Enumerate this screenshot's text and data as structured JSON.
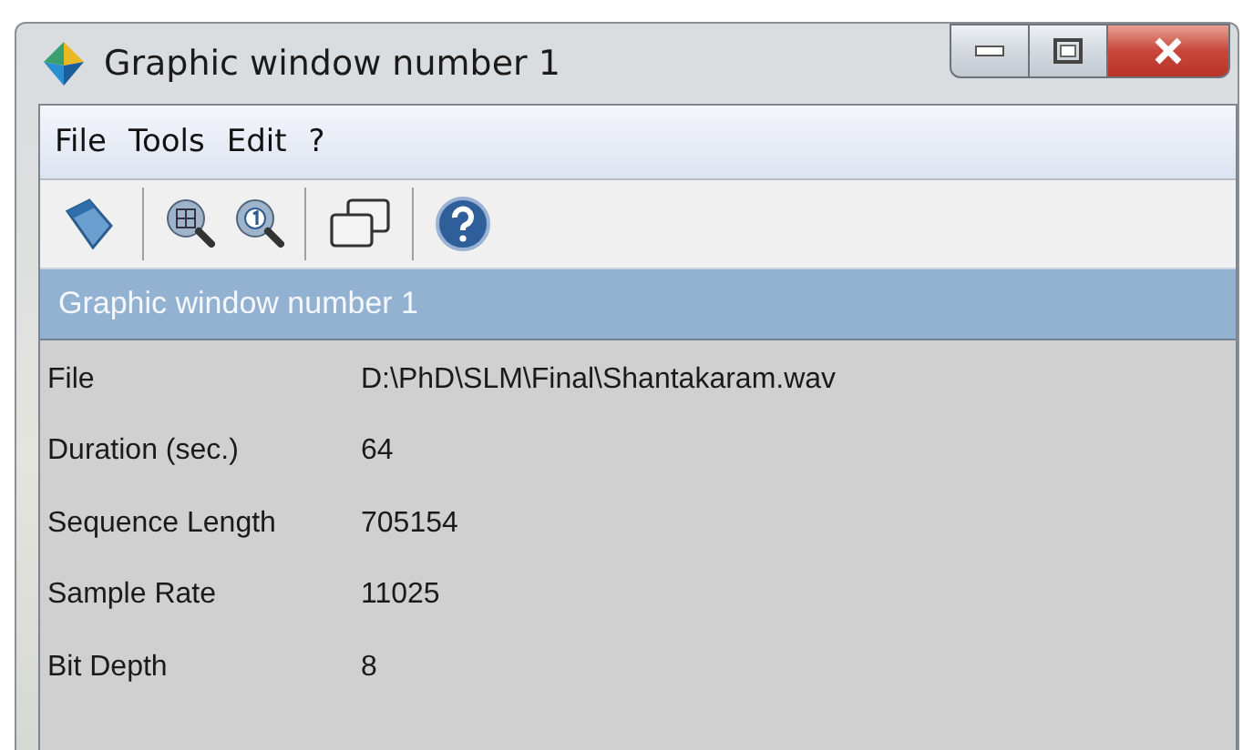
{
  "window": {
    "title": "Graphic window number 1"
  },
  "menu": [
    "File",
    "Tools",
    "Edit",
    "?"
  ],
  "toolbar": [
    {
      "kind": "export"
    },
    {
      "kind": "zoom-grid"
    },
    {
      "kind": "zoom-one"
    },
    {
      "kind": "windows"
    },
    {
      "kind": "help"
    }
  ],
  "panel": {
    "title": "Graphic window number 1",
    "rows": [
      {
        "label": "File",
        "value": "D:\\PhD\\SLM\\Final\\Shantakaram.wav"
      },
      {
        "label": "Duration (sec.)",
        "value": "64"
      },
      {
        "label": "Sequence Length",
        "value": "705154"
      },
      {
        "label": "Sample Rate",
        "value": "11025"
      },
      {
        "label": "Bit Depth",
        "value": "8"
      }
    ]
  }
}
